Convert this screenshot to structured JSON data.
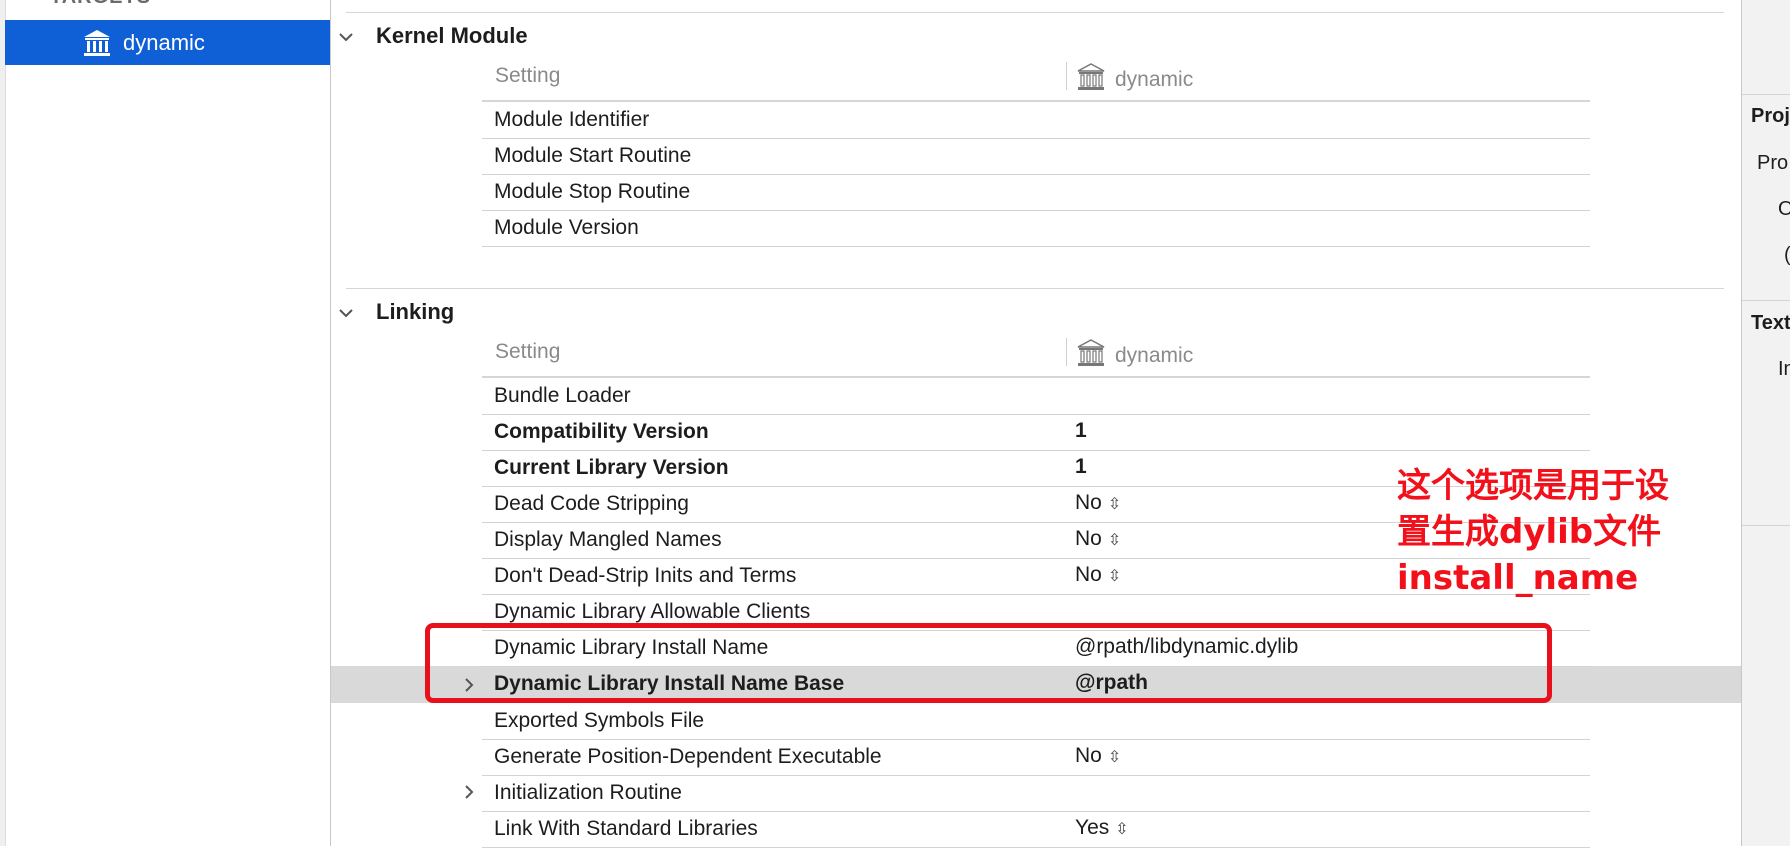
{
  "sidebar": {
    "header": "TARGETS",
    "target": {
      "label": "dynamic",
      "icon": "building-columns-icon"
    }
  },
  "sections": [
    {
      "title": "Kernel Module",
      "setting_header": "Setting",
      "target_header": "dynamic",
      "rows": [
        {
          "name": "Module Identifier",
          "value": ""
        },
        {
          "name": "Module Start Routine",
          "value": ""
        },
        {
          "name": "Module Stop Routine",
          "value": ""
        },
        {
          "name": "Module Version",
          "value": ""
        }
      ]
    },
    {
      "title": "Linking",
      "setting_header": "Setting",
      "target_header": "dynamic",
      "rows": [
        {
          "name": "Bundle Loader",
          "value": ""
        },
        {
          "name": "Compatibility Version",
          "value": "1"
        },
        {
          "name": "Current Library Version",
          "value": "1"
        },
        {
          "name": "Dead Code Stripping",
          "value": "No"
        },
        {
          "name": "Display Mangled Names",
          "value": "No"
        },
        {
          "name": "Don't Dead-Strip Inits and Terms",
          "value": "No"
        },
        {
          "name": "Dynamic Library Allowable Clients",
          "value": ""
        },
        {
          "name": "Dynamic Library Install Name",
          "value": "@rpath/libdynamic.dylib"
        },
        {
          "name": "Dynamic Library Install Name Base",
          "value": "@rpath"
        },
        {
          "name": "Exported Symbols File",
          "value": ""
        },
        {
          "name": "Generate Position-Dependent Executable",
          "value": "No"
        },
        {
          "name": "Initialization Routine",
          "value": ""
        },
        {
          "name": "Link With Standard Libraries",
          "value": "Yes"
        }
      ]
    }
  ],
  "inspector": {
    "project_header": "Proj",
    "project_row1": "Pro",
    "project_row2": "O",
    "project_row3": "(",
    "text_header": "Text",
    "text_row1": "In"
  },
  "annotation": {
    "line1": "这个选项是用于设",
    "line2": "置生成dylib文件",
    "line3": "install_name",
    "color": "#f2101b"
  },
  "colors": {
    "selection": "#0f5fd6",
    "row_highlight": "#d9d9d9"
  }
}
